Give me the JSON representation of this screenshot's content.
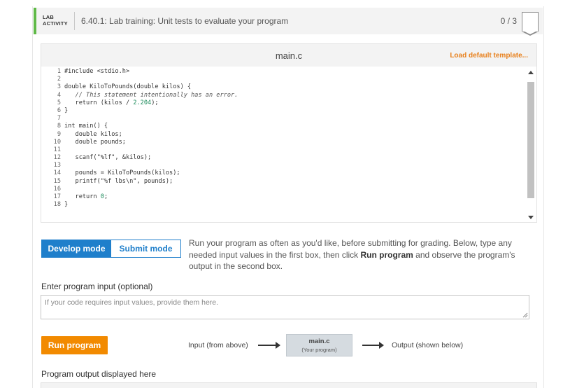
{
  "header": {
    "badge_line1": "LAB",
    "badge_line2": "ACTIVITY",
    "title": "6.40.1: Lab training: Unit tests to evaluate your program",
    "score": "0 / 3",
    "accent_color": "#5fb947"
  },
  "editor": {
    "filename": "main.c",
    "load_default_label": "Load default template...",
    "lines": [
      {
        "n": "1",
        "segs": [
          {
            "t": "#include <stdio.h>"
          }
        ]
      },
      {
        "n": "2",
        "segs": [
          {
            "t": ""
          }
        ]
      },
      {
        "n": "3",
        "segs": [
          {
            "t": "double KiloToPounds(double kilos) {"
          }
        ]
      },
      {
        "n": "4",
        "segs": [
          {
            "t": "   "
          },
          {
            "t": "// This statement intentionally has an error.",
            "c": "cmt"
          }
        ]
      },
      {
        "n": "5",
        "segs": [
          {
            "t": "   return (kilos / "
          },
          {
            "t": "2.204",
            "c": "num"
          },
          {
            "t": ");"
          }
        ]
      },
      {
        "n": "6",
        "segs": [
          {
            "t": "}"
          }
        ]
      },
      {
        "n": "7",
        "segs": [
          {
            "t": ""
          }
        ]
      },
      {
        "n": "8",
        "segs": [
          {
            "t": "int main() {"
          }
        ]
      },
      {
        "n": "9",
        "segs": [
          {
            "t": "   double kilos;"
          }
        ]
      },
      {
        "n": "10",
        "segs": [
          {
            "t": "   double pounds;"
          }
        ]
      },
      {
        "n": "11",
        "segs": [
          {
            "t": ""
          }
        ]
      },
      {
        "n": "12",
        "segs": [
          {
            "t": "   scanf(\"%lf\", &kilos);"
          }
        ]
      },
      {
        "n": "13",
        "segs": [
          {
            "t": ""
          }
        ]
      },
      {
        "n": "14",
        "segs": [
          {
            "t": "   pounds = KiloToPounds(kilos);"
          }
        ]
      },
      {
        "n": "15",
        "segs": [
          {
            "t": "   printf(\"%f lbs\\n\", pounds);"
          }
        ]
      },
      {
        "n": "16",
        "segs": [
          {
            "t": ""
          }
        ]
      },
      {
        "n": "17",
        "segs": [
          {
            "t": "   return "
          },
          {
            "t": "0",
            "c": "num"
          },
          {
            "t": ";"
          }
        ]
      },
      {
        "n": "18",
        "segs": [
          {
            "t": "}"
          }
        ]
      }
    ]
  },
  "modes": {
    "develop_label": "Develop mode",
    "submit_label": "Submit mode"
  },
  "instructions": {
    "part1": "Run your program as often as you'd like, before submitting for grading. Below, type any needed input values in the first box, then click ",
    "bold": "Run program",
    "part2": " and observe the program's output in the second box."
  },
  "input": {
    "label": "Enter program input (optional)",
    "placeholder": "If your code requires input values, provide them here."
  },
  "run": {
    "button_label": "Run program",
    "flow_input_label": "Input (from above)",
    "flow_box_title": "main.c",
    "flow_box_subtitle": "(Your program)",
    "flow_output_label": "Output (shown below)"
  },
  "output": {
    "label": "Program output displayed here"
  },
  "colors": {
    "primary_blue": "#1f7fcb",
    "run_orange": "#f28a00",
    "link_orange": "#e8801c"
  }
}
